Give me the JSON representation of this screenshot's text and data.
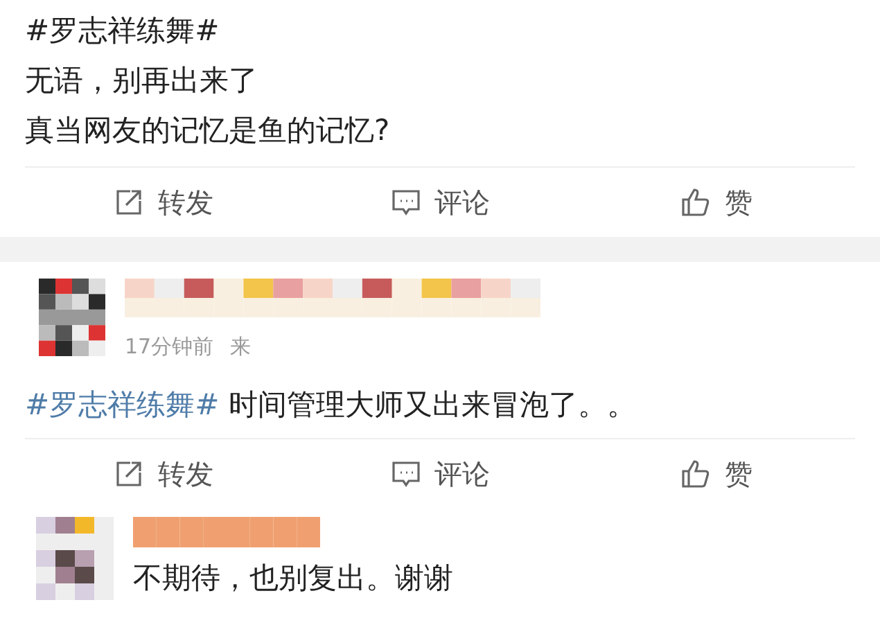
{
  "posts": [
    {
      "kind": "body",
      "hashtag": "#罗志祥练舞#",
      "lines": [
        "无语，别再出来了",
        "真当网友的记忆是鱼的记忆?"
      ],
      "actions": [
        "转发",
        "评论",
        "赞"
      ]
    },
    {
      "kind": "repost",
      "time": "17分钟前",
      "source": "来",
      "hashtag": "#罗志祥练舞#",
      "text": "时间管理大师又出来冒泡了。。",
      "actions": [
        "转发",
        "评论",
        "赞"
      ]
    },
    {
      "kind": "comment",
      "text": "不期待，也别复出。谢谢"
    }
  ]
}
